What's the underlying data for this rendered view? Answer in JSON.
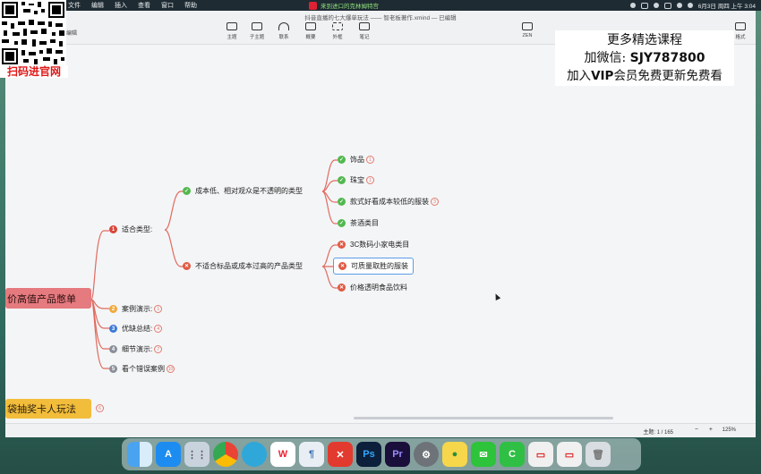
{
  "menubar": {
    "menus": [
      "文件",
      "编辑",
      "插入",
      "查看",
      "窗口",
      "帮助"
    ],
    "now_playing": "来到进口的克林姆特宫",
    "clock": "6月3日 周四 上午 3:04"
  },
  "window": {
    "doc_title": "抖音直播的七大爆单玩法 —— 智老板著作.xmind — 已编辑",
    "left_label": "编辑",
    "toolbar": {
      "topic": "主题",
      "subtopic": "子主题",
      "relationship": "联系",
      "summary": "概要",
      "boundary": "外框",
      "note": "笔记",
      "zen": "ZEN",
      "format": "格式"
    }
  },
  "promo": {
    "line1": "更多精选课程",
    "line2_prefix": "加微信: ",
    "line2_id": "SJY787800",
    "line3_prefix": "加入",
    "line3_vip": "VIP",
    "line3_suffix": "会员免费更新免费看"
  },
  "qr": {
    "caption": "扫码进官网"
  },
  "mindmap": {
    "root": "价高值产品憋单",
    "root2": "袋抽奖卡人玩法",
    "root2_count": "6",
    "branch1": {
      "label": "适合类型:",
      "num": "1",
      "group_a": {
        "label": "成本低、相对观众是不透明的类型",
        "items": [
          {
            "label": "饰品",
            "count": "1"
          },
          {
            "label": "珠宝",
            "count": "1"
          },
          {
            "label": "款式好看成本较低的服装",
            "count": "3"
          },
          {
            "label": "茶酒类目",
            "count": ""
          }
        ]
      },
      "group_b": {
        "label": "不适合标品或成本过高的产品类型",
        "items": [
          {
            "label": "3C数码小家电类目"
          },
          {
            "label": "可质量取胜的服装"
          },
          {
            "label": "价格透明食品饮料"
          }
        ]
      }
    },
    "branch2": {
      "label": "案例演示:",
      "num": "2",
      "count": "1"
    },
    "branch3": {
      "label": "优缺总结:",
      "num": "3",
      "count": "4"
    },
    "branch4": {
      "label": "细节演示:",
      "num": "4",
      "count": "7"
    },
    "branch5": {
      "label": "看个错误案例",
      "num": "5",
      "count": "10"
    }
  },
  "status": {
    "topic_count": "主题: 1 / 165",
    "zoom": "125%",
    "zoom_minus": "−",
    "zoom_plus": "+"
  },
  "dock": {
    "apps": [
      "Finder",
      "App Store",
      "Launchpad",
      "Chrome",
      "Safari",
      "WPS",
      "Script",
      "XMind",
      "Ps",
      "Pr",
      "Settings",
      "Maps",
      "WeChat",
      "Mail",
      "Preview",
      "Notes",
      "Trash"
    ]
  }
}
